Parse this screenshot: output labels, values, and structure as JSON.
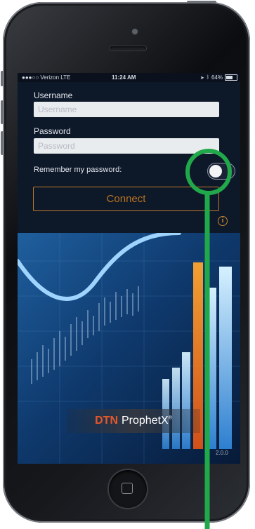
{
  "status_bar": {
    "carrier": "●●●○○ Verizon  LTE",
    "time": "11:24 AM",
    "battery_text": "64%",
    "battery_level": 0.64
  },
  "login": {
    "username_label": "Username",
    "username_placeholder": "Username",
    "password_label": "Password",
    "password_placeholder": "Password",
    "remember_label": "Remember my password:",
    "remember_enabled": false,
    "connect_label": "Connect",
    "info_glyph": "i"
  },
  "brand": {
    "dtn": "DTN",
    "product": "ProphetX",
    "registered": "®"
  },
  "version": "2.0.0",
  "colors": {
    "accent_orange": "#c07a2a",
    "annotation_green": "#21a84a",
    "screen_bg": "#0d1829",
    "brand_red": "#e8572b"
  },
  "icons": {
    "info": "info-icon",
    "home": "home-button-icon",
    "battery": "battery-icon",
    "bluetooth": "bluetooth-icon",
    "location": "location-arrow-icon"
  }
}
